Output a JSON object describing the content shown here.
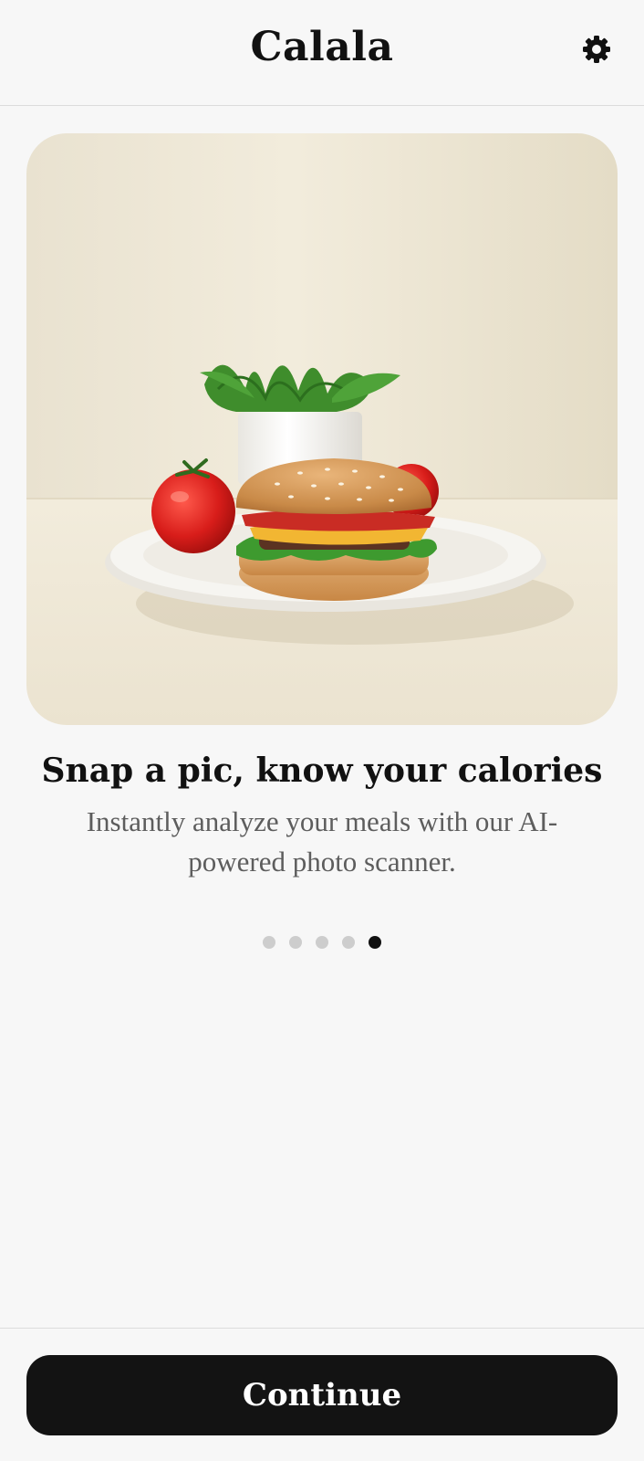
{
  "header": {
    "title": "Calala",
    "settings_icon": "gear-icon"
  },
  "onboarding": {
    "image_alt": "",
    "headline": "Snap a pic, know your calories",
    "subtitle": "Instantly analyze your meals with our AI-powered photo scanner.",
    "page_count": 5,
    "current_page": 5
  },
  "footer": {
    "continue_label": "Continue"
  },
  "colors": {
    "background": "#f7f7f7",
    "primary_button": "#131313",
    "dot_inactive": "#cdcdcd",
    "dot_active": "#111111",
    "subtitle_text": "#5d5d5d"
  }
}
